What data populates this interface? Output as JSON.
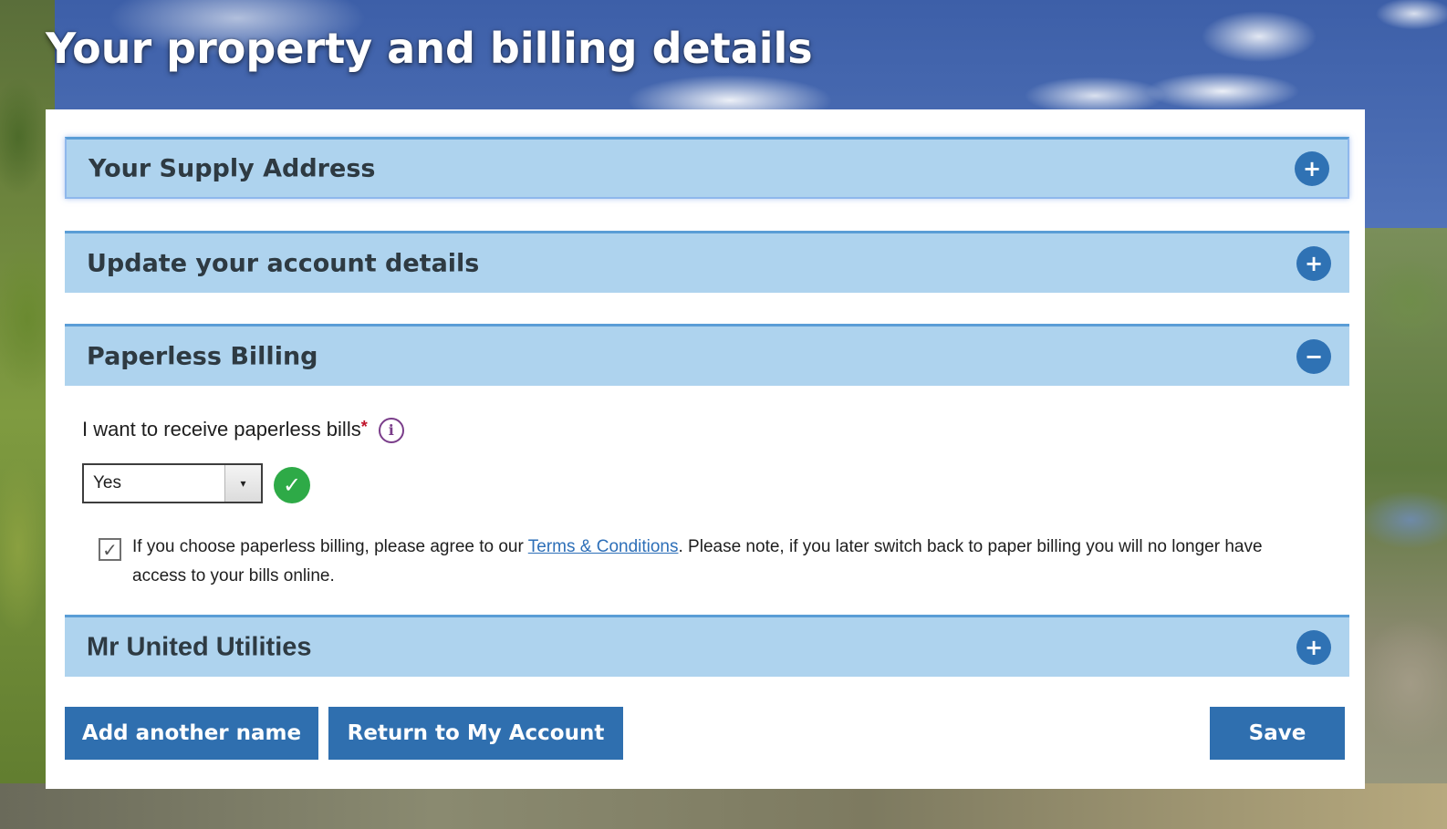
{
  "page": {
    "title": "Your property and billing details"
  },
  "sections": [
    {
      "label": "Your Supply Address",
      "toggle": "+",
      "state": "collapsed"
    },
    {
      "label": "Update your account details",
      "toggle": "+",
      "state": "collapsed"
    },
    {
      "label": "Paperless Billing",
      "toggle": "−",
      "state": "expanded"
    },
    {
      "label": "Mr United Utilities",
      "toggle": "+",
      "state": "collapsed"
    }
  ],
  "paperless": {
    "question": "I want to receive paperless bills",
    "required_marker": "*",
    "info_icon": "i",
    "select_value": "Yes",
    "select_arrow": "▾",
    "valid_icon": "✓",
    "checkbox_mark": "✓",
    "checkbox_checked": true,
    "agree_before": "If you choose paperless billing, please agree to our ",
    "agree_link": "Terms & Conditions",
    "agree_after": ". Please note, if you later switch back to paper billing you will no longer have access to your bills online."
  },
  "buttons": {
    "add_name": "Add another name",
    "return": "Return to My Account",
    "save": "Save"
  },
  "colors": {
    "accordion_bg": "#aed3ee",
    "accordion_border": "#5a9dd6",
    "button_bg": "#2f6faf",
    "toggle_bg": "#2f72b4",
    "valid_green": "#2eaa47",
    "required_red": "#c0132a",
    "info_purple": "#7a3d8a",
    "link_blue": "#2d6fb8"
  }
}
